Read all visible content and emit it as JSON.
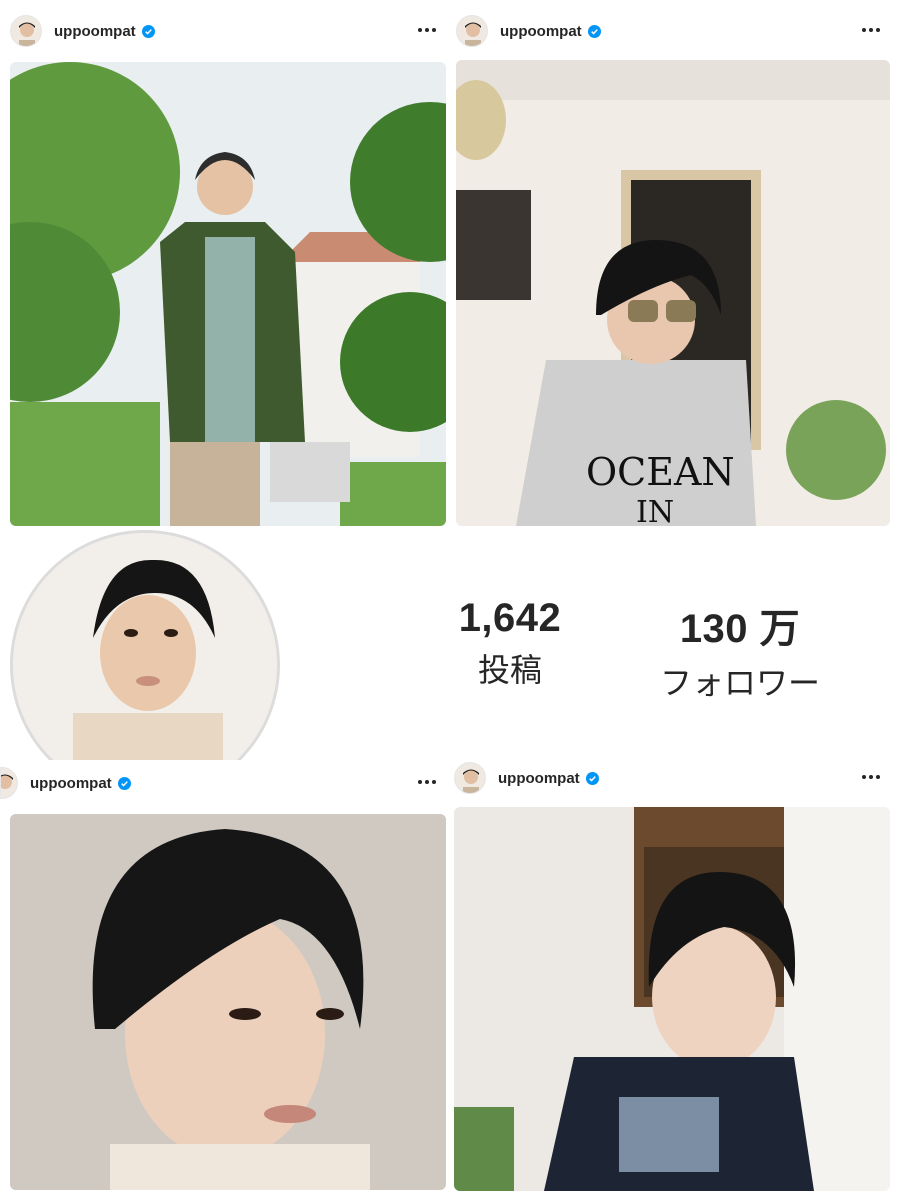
{
  "posts": [
    {
      "username": "uppoompat",
      "verified": true
    },
    {
      "username": "uppoompat",
      "verified": true
    },
    {
      "username": "uppoompat",
      "verified": true
    },
    {
      "username": "uppoompat",
      "verified": true
    }
  ],
  "profile": {
    "stats": [
      {
        "value": "1,642",
        "label": "投稿"
      },
      {
        "value": "130 万",
        "label": "フォロワー"
      }
    ]
  },
  "colors": {
    "verified_blue": "#0095f6",
    "text": "#262626"
  },
  "icons": [
    "verified-badge-icon",
    "more-options-icon"
  ]
}
